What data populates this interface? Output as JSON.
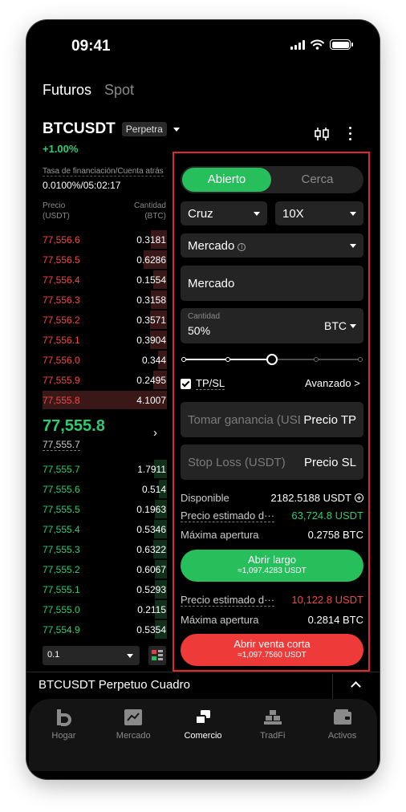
{
  "status": {
    "time": "09:41"
  },
  "nav": {
    "tabs": [
      "Futuros",
      "Spot"
    ]
  },
  "pair": {
    "name": "BTCUSDT",
    "badge": "Perpetra",
    "change": "+1.00%"
  },
  "orderbook": {
    "funding_label": "Tasa de financiación/Cuenta atrás",
    "funding_value": "0.0100%/05:02:17",
    "price_header": [
      "Precio",
      "(USDT)"
    ],
    "qty_header": [
      "Cantidad",
      "(BTC)"
    ],
    "asks": [
      {
        "price": "77,556.6",
        "qty": "0.3181",
        "depth": 0.36
      },
      {
        "price": "77,556.5",
        "qty": "0.6286",
        "depth": 0.51
      },
      {
        "price": "77,556.4",
        "qty": "0.1554",
        "depth": 0.3
      },
      {
        "price": "77,556.3",
        "qty": "0.3158",
        "depth": 0.35
      },
      {
        "price": "77,556.2",
        "qty": "0.3571",
        "depth": 0.37
      },
      {
        "price": "77,556.1",
        "qty": "0.3904",
        "depth": 0.38
      },
      {
        "price": "77,556.0",
        "qty": "0.344",
        "depth": 0.19
      },
      {
        "price": "77,555.9",
        "qty": "0.2495",
        "depth": 0.3
      },
      {
        "price": "77,555.8",
        "qty": "4.1007",
        "depth": 1.0
      }
    ],
    "mid_price": "77,555.8",
    "mark_price": "77,555.7",
    "bids": [
      {
        "price": "77,555.7",
        "qty": "1.7911",
        "depth": 0.29
      },
      {
        "price": "77,555.6",
        "qty": "0.514",
        "depth": 0.18
      },
      {
        "price": "77,555.5",
        "qty": "0.1963",
        "depth": 0.27
      },
      {
        "price": "77,555.4",
        "qty": "0.5346",
        "depth": 0.28
      },
      {
        "price": "77,555.3",
        "qty": "0.6322",
        "depth": 0.3
      },
      {
        "price": "77,555.2",
        "qty": "0.6067",
        "depth": 0.27
      },
      {
        "price": "77,555.1",
        "qty": "0.5293",
        "depth": 0.26
      },
      {
        "price": "77,555.0",
        "qty": "0.2115",
        "depth": 0.26
      },
      {
        "price": "77,554.9",
        "qty": "0.5354",
        "depth": 0.26
      }
    ],
    "depth_value": "0.1"
  },
  "form": {
    "toggle_on": "Abierto",
    "toggle_off": "Cerca",
    "margin_mode": "Cruz",
    "leverage": "10X",
    "order_type": "Mercado",
    "price_field": "Mercado",
    "qty_label": "Cantidad",
    "qty_value": "50%",
    "qty_unit": "BTC",
    "slider_pct": 0.5,
    "tpsl": "TP/SL",
    "advanced": "Avanzado >",
    "tp_placeholder": "Tomar ganancia (USDT)",
    "tp_unit": "Precio TP",
    "sl_placeholder": "Stop Loss (USDT)",
    "sl_unit": "Precio SL",
    "available_label": "Disponible",
    "available_value": "2182.5188 USDT",
    "long_est_label": "Precio estimado d···",
    "long_est_value": "63,724.8 USDT",
    "long_max_label": "Máxima apertura",
    "long_max_value": "0.2758 BTC",
    "long_btn": "Abrir largo",
    "long_btn_sub": "≈1,097.4283 USDT",
    "short_est_label": "Precio estimado d···",
    "short_est_value": "10,122.8 USDT",
    "short_max_label": "Máxima apertura",
    "short_max_value": "0.2814 BTC",
    "short_btn": "Abrir venta corta",
    "short_btn_sub": "≈1,097.7560 USDT"
  },
  "bottom": {
    "title": "BTCUSDT Perpetuo Cuadro"
  },
  "tabbar": {
    "items": [
      "Hogar",
      "Mercado",
      "Comercio",
      "TradFi",
      "Activos"
    ]
  },
  "colors": {
    "green": "#27be5c",
    "red": "#f04848",
    "highlight": "#e0282c"
  }
}
